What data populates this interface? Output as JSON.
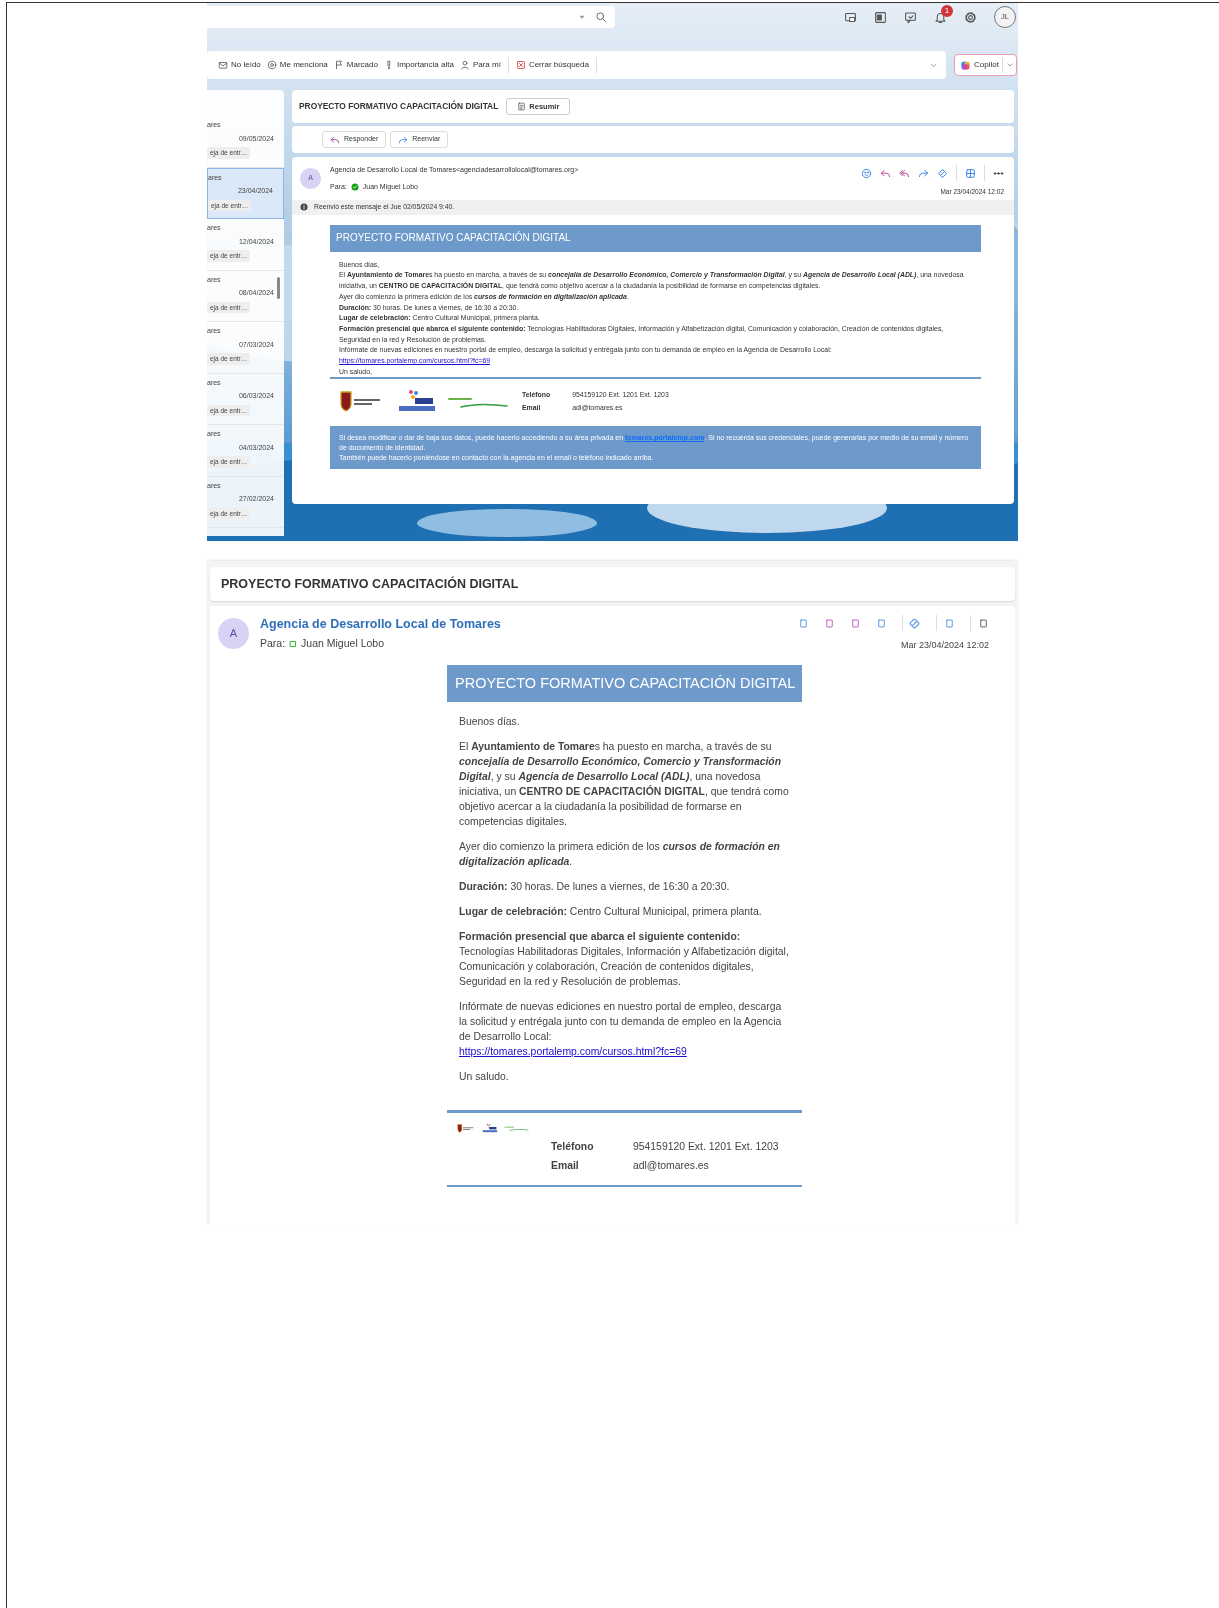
{
  "top_window": {
    "notification_count": "1",
    "avatar": "JL",
    "filters": [
      "No leído",
      "Me menciona",
      "Marcado",
      "Importancia alta",
      "Para mí",
      "Cerrar búsqueda"
    ],
    "copilot": "Copilot",
    "messages": [
      {
        "sender": "ares",
        "date": "09/05/2024",
        "folder": "eja de entr…",
        "selected": false
      },
      {
        "sender": "ares",
        "date": "23/04/2024",
        "folder": "eja de entr…",
        "selected": true
      },
      {
        "sender": "ares",
        "date": "12/04/2024",
        "folder": "eja de entr…",
        "selected": false
      },
      {
        "sender": "ares",
        "date": "08/04/2024",
        "folder": "eja de entr…",
        "selected": false
      },
      {
        "sender": "ares",
        "date": "07/03/2024",
        "folder": "eja de entr…",
        "selected": false
      },
      {
        "sender": "ares",
        "date": "06/03/2024",
        "folder": "eja de entr…",
        "selected": false
      },
      {
        "sender": "ares",
        "date": "04/03/2024",
        "folder": "eja de entr…",
        "selected": false
      },
      {
        "sender": "ares",
        "date": "27/02/2024",
        "folder": "eja de entr…",
        "selected": false
      }
    ],
    "subject": "PROYECTO FORMATIVO CAPACITACIÓN DIGITAL",
    "summarize": "Resumir",
    "actions": [
      "Responder",
      "Reenviar"
    ],
    "message": {
      "avatar": "A",
      "sender": "Agencia de Desarrollo Local de Tomares<agenciadesarrollolocal@tomares.org>",
      "to_label": "Para:",
      "to": "Juan Miguel Lobo",
      "date": "Mar 23/04/2024 12:02",
      "forward_note": "Reenvió este mensaje el Jue 02/05/2024 9:40.",
      "email": {
        "title": "PROYECTO FORMATIVO CAPACITACIÓN DIGITAL",
        "paragraphs": [
          "Buenos días,",
          "El **Ayuntamiento de Tomare**s ha puesto en marcha, a través de su *concejalía de Desarrollo Económico, Comercio y Transformación Digital*, y su *Agencia de Desarrollo Local (ADL)*, una novedosa iniciativa, un **CENTRO DE CAPACITACIÓN DIGITAL**, que tendrá como objetivo acercar a la ciudadanía la posibilidad de formarse en competencias digitales.",
          "Ayer dio comienzo la primera edición de los *cursos de formación en digitalización aplicada*.",
          "**Duración:** 30 horas. De lunes a viernes, de 16:30 a 20:30.",
          "**Lugar de celebración:** Centro Cultural Municipal, primera planta.",
          "**Formación presencial que abarca el siguiente contenido:** Tecnologías Habilitadoras Digitales, Información y Alfabetización digital, Comunicación y colaboración, Creación de contenidos digitales, Seguridad en la red y Resolución de problemas.",
          "Infórmate de nuevas ediciones en nuestro portal de empleo, descarga la solicitud y entrégala junto con tu demanda de empleo en la Agencia de Desarrollo Local:"
        ],
        "link": "https://tomares.portalemp.com/cursos.html?fc=69",
        "closing": "Un saludo,",
        "signature": {
          "phone_label": "Teléfono",
          "phone": "954159120 Ext. 1201 Ext. 1203",
          "email_label": "Email",
          "email": "adl@tomares.es"
        },
        "footer": {
          "before": "Si desea modificar o dar de baja sus datos, puede hacerlo accediendo a su área privada en ",
          "link": "tomares.portalemp.com",
          "after": ". Si no recuerda sus credenciales, puede generarlas por medio de su email y número de documento de identidad.",
          "note": "También puede hacerlo poniéndose en contacto con la agencia en el email o teléfono indicado arriba."
        }
      }
    }
  },
  "bottom_window": {
    "subject": "PROYECTO FORMATIVO CAPACITACIÓN DIGITAL",
    "message": {
      "avatar": "A",
      "sender": "Agencia de Desarrollo Local de Tomares",
      "to_label": "Para:",
      "to": "Juan Miguel Lobo",
      "date": "Mar 23/04/2024 12:02",
      "email": {
        "title": "PROYECTO FORMATIVO CAPACITACIÓN DIGITAL",
        "paragraphs": [
          "Buenos días.",
          "El **Ayuntamiento de Tomare**s ha puesto en marcha, a través de su *concejalía de Desarrollo Económico, Comercio y Transformación Digital*, y su *Agencia de Desarrollo Local (ADL)*, una novedosa iniciativa, un **CENTRO DE CAPACITACIÓN DIGITAL**, que tendrá como objetivo acercar a la ciudadanía la posibilidad de formarse en competencias digitales.",
          "Ayer dio comienzo la primera edición de los *cursos de formación en digitalización aplicada*.",
          "**Duración:** 30 horas. De lunes a viernes, de 16:30 a 20:30.",
          "**Lugar de celebración:** Centro Cultural Municipal, primera planta.",
          "**Formación presencial que abarca el siguiente contenido:** Tecnologías Habilitadoras Digitales, Información y Alfabetización digital, Comunicación y colaboración, Creación de contenidos digitales, Seguridad en la red y Resolución de problemas.",
          "Infórmate de nuevas ediciones en nuestro portal de empleo, descarga la solicitud y entrégala junto con tu demanda de empleo en la Agencia de Desarrollo Local:"
        ],
        "link": "https://tomares.portalemp.com/cursos.html?fc=69",
        "closing": "Un saludo.",
        "signature": {
          "phone_label": "Teléfono",
          "phone": "954159120 Ext. 1201 Ext. 1203",
          "email_label": "Email",
          "email": "adl@tomares.es"
        }
      }
    }
  }
}
